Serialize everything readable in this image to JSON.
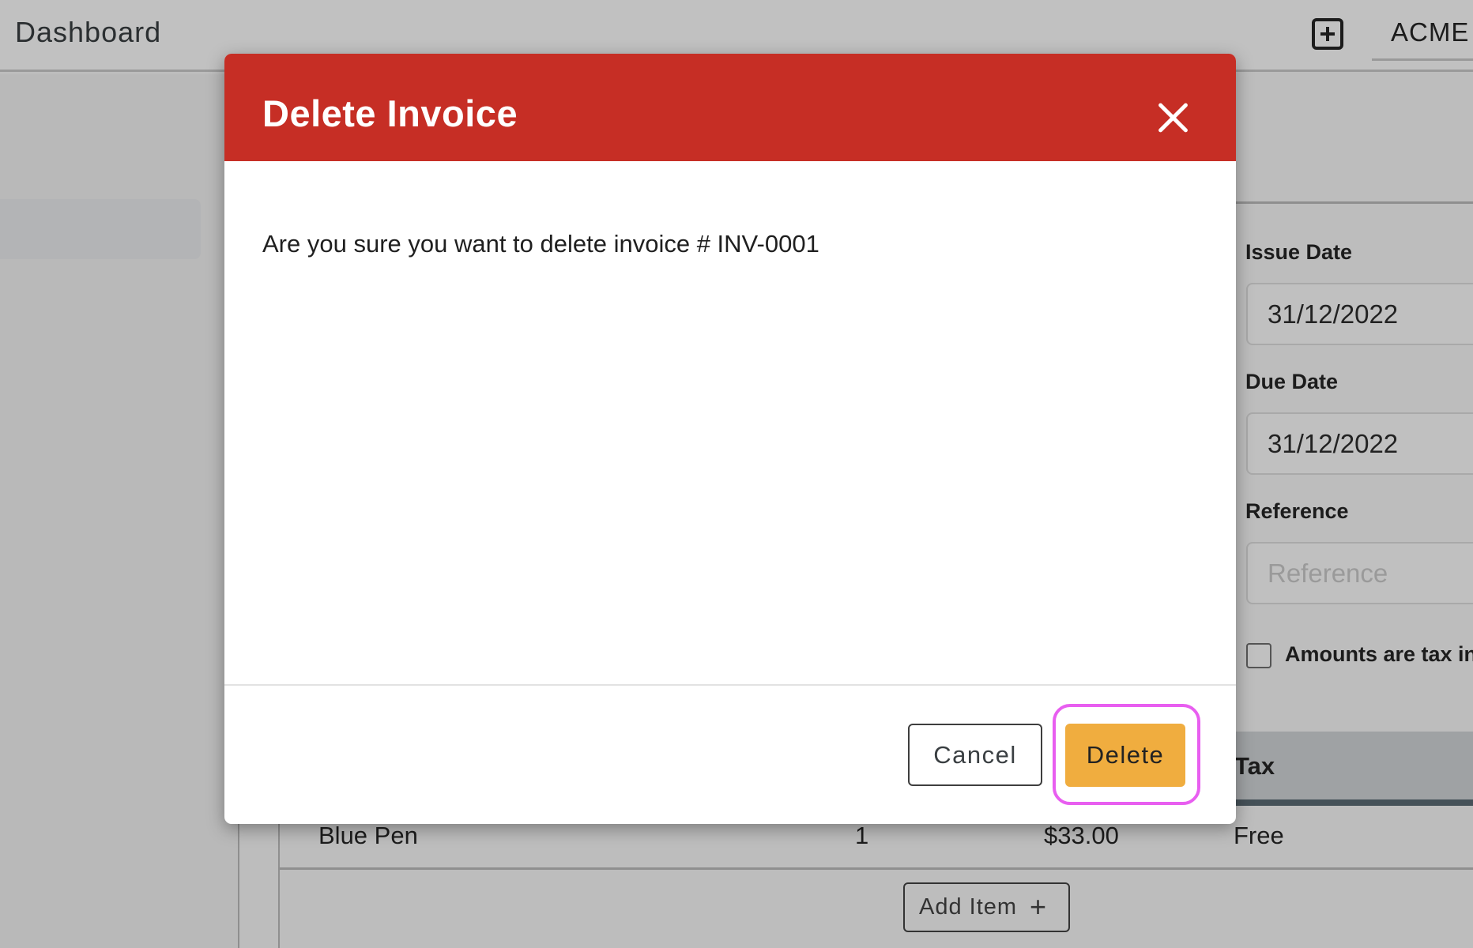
{
  "app": {
    "title": "Dashboard",
    "organization": "ACME",
    "new_icon": "plus-square-icon"
  },
  "invoice_panel": {
    "issue_date_label": "Issue Date",
    "issue_date_value": "31/12/2022",
    "due_date_label": "Due Date",
    "due_date_value": "31/12/2022",
    "reference_label": "Reference",
    "reference_placeholder": "Reference",
    "tax_inclusive_label": "Amounts are tax inc",
    "tax_inclusive_checked": false
  },
  "items_table": {
    "columns": [
      "Tax"
    ],
    "rows": [
      {
        "item": "Blue Pen",
        "quantity": "1",
        "price": "$33.00",
        "tax": "Free"
      }
    ],
    "add_item_label": "Add Item",
    "add_item_icon": "+"
  },
  "modal": {
    "title": "Delete Invoice",
    "close_icon": "close-icon",
    "message": "Are you sure you want to delete invoice # INV-0001",
    "cancel_label": "Cancel",
    "confirm_label": "Delete",
    "colors": {
      "header": "#c62e25",
      "confirm": "#f0ad3f",
      "focus_ring": "#e85ef0"
    }
  }
}
